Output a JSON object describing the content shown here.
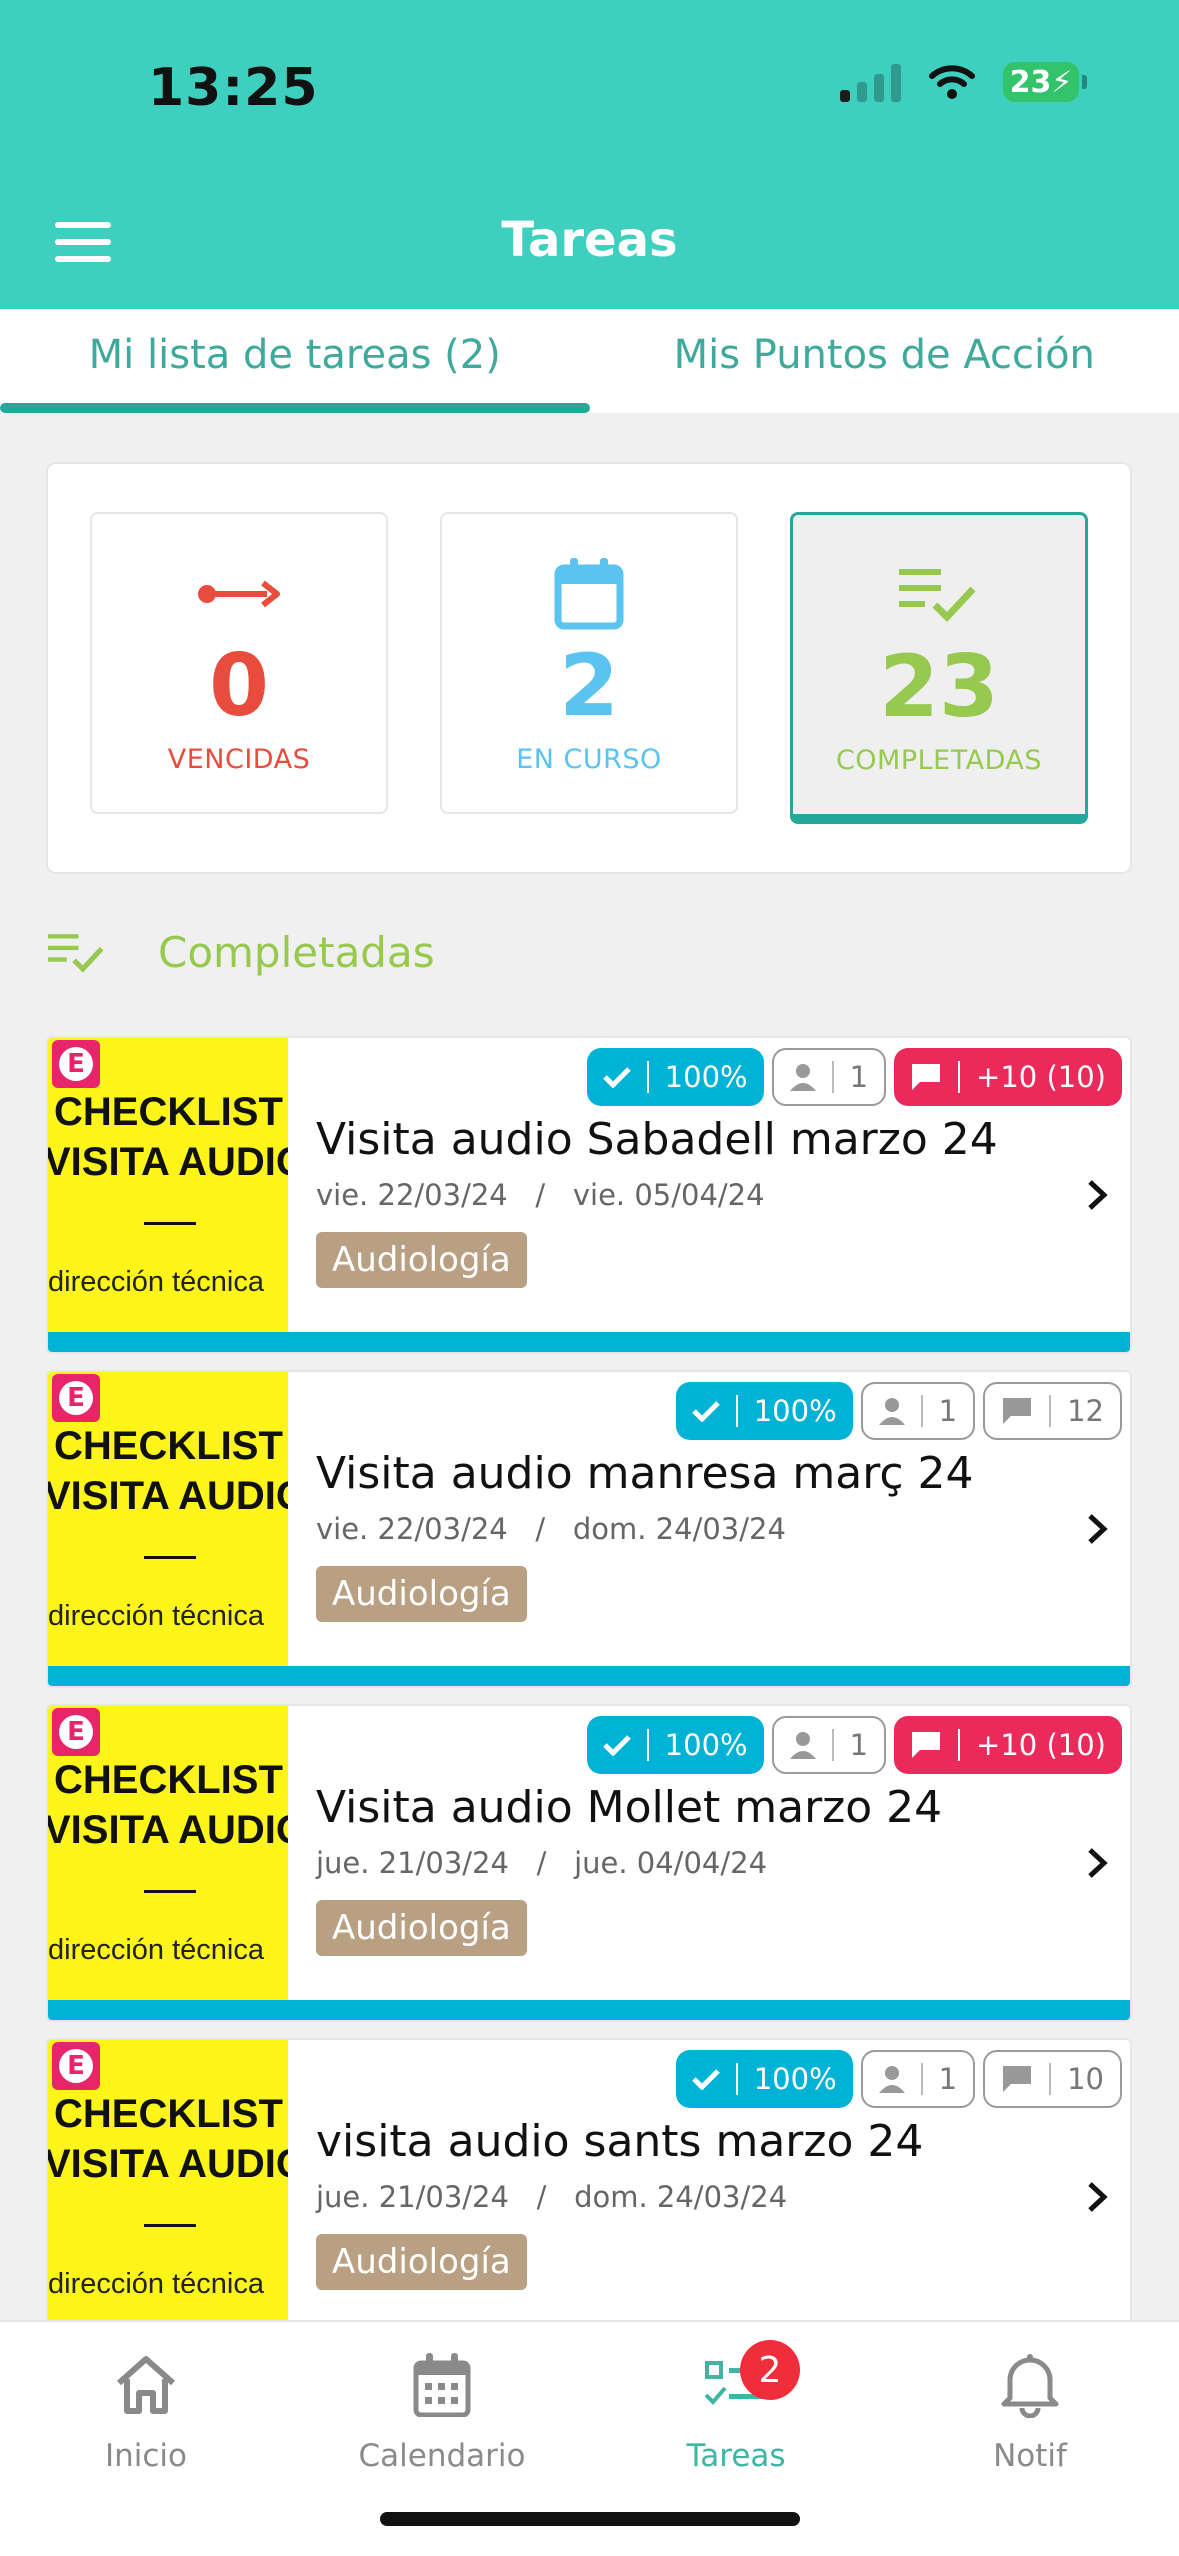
{
  "status_bar": {
    "time": "13:25",
    "battery": "23"
  },
  "header": {
    "title": "Tareas",
    "menu_icon": "hamburger-menu-icon"
  },
  "tabs": [
    {
      "label": "Mi lista de tareas (2)",
      "active": true
    },
    {
      "label": "Mis Puntos de Acción",
      "active": false
    }
  ],
  "summary": [
    {
      "icon": "arrow-right-icon",
      "value": "0",
      "label": "VENCIDAS",
      "color": "#e74c3c"
    },
    {
      "icon": "calendar-icon",
      "value": "2",
      "label": "EN CURSO",
      "color": "#5bc3f0"
    },
    {
      "icon": "list-check-icon",
      "value": "23",
      "label": "COMPLETADAS",
      "color": "#96c94d",
      "active": true
    }
  ],
  "section": {
    "title": "Completadas",
    "icon": "list-check-icon"
  },
  "thumbnail": {
    "badge": "E",
    "line1": "CHECKLIST",
    "line2": "VISITA AUDIO",
    "line3": "dirección técnica"
  },
  "tasks": [
    {
      "title": "Visita audio Sabadell marzo 24",
      "start": "vie. 22/03/24",
      "end": "vie. 05/04/24",
      "sep": "/",
      "progress": "100%",
      "progress_value": 1.0,
      "users": "1",
      "comments": "+10 (10)",
      "comments_alert": true,
      "tag": "Audiología"
    },
    {
      "title": "Visita audio manresa març 24",
      "start": "vie. 22/03/24",
      "end": "dom. 24/03/24",
      "sep": "/",
      "progress": "100%",
      "progress_value": 1.0,
      "users": "1",
      "comments": "12",
      "comments_alert": false,
      "tag": "Audiología"
    },
    {
      "title": "Visita audio Mollet marzo 24",
      "start": "jue. 21/03/24",
      "end": "jue. 04/04/24",
      "sep": "/",
      "progress": "100%",
      "progress_value": 1.0,
      "users": "1",
      "comments": "+10 (10)",
      "comments_alert": true,
      "tag": "Audiología"
    },
    {
      "title": "visita audio sants marzo 24",
      "start": "jue. 21/03/24",
      "end": "dom. 24/03/24",
      "sep": "/",
      "progress": "100%",
      "progress_value": 1.0,
      "users": "1",
      "comments": "10",
      "comments_alert": false,
      "tag": "Audiología"
    }
  ],
  "tabbar": [
    {
      "label": "Inicio",
      "icon": "home-icon"
    },
    {
      "label": "Calendario",
      "icon": "calendar-icon"
    },
    {
      "label": "Tareas",
      "icon": "tasks-icon",
      "active": true,
      "badge": "2"
    },
    {
      "label": "Notif",
      "icon": "bell-icon"
    }
  ],
  "colors": {
    "teal": "#3ecfbe",
    "progress": "#00b3d6",
    "alert": "#ea2a5a",
    "tag": "#b9a083"
  }
}
